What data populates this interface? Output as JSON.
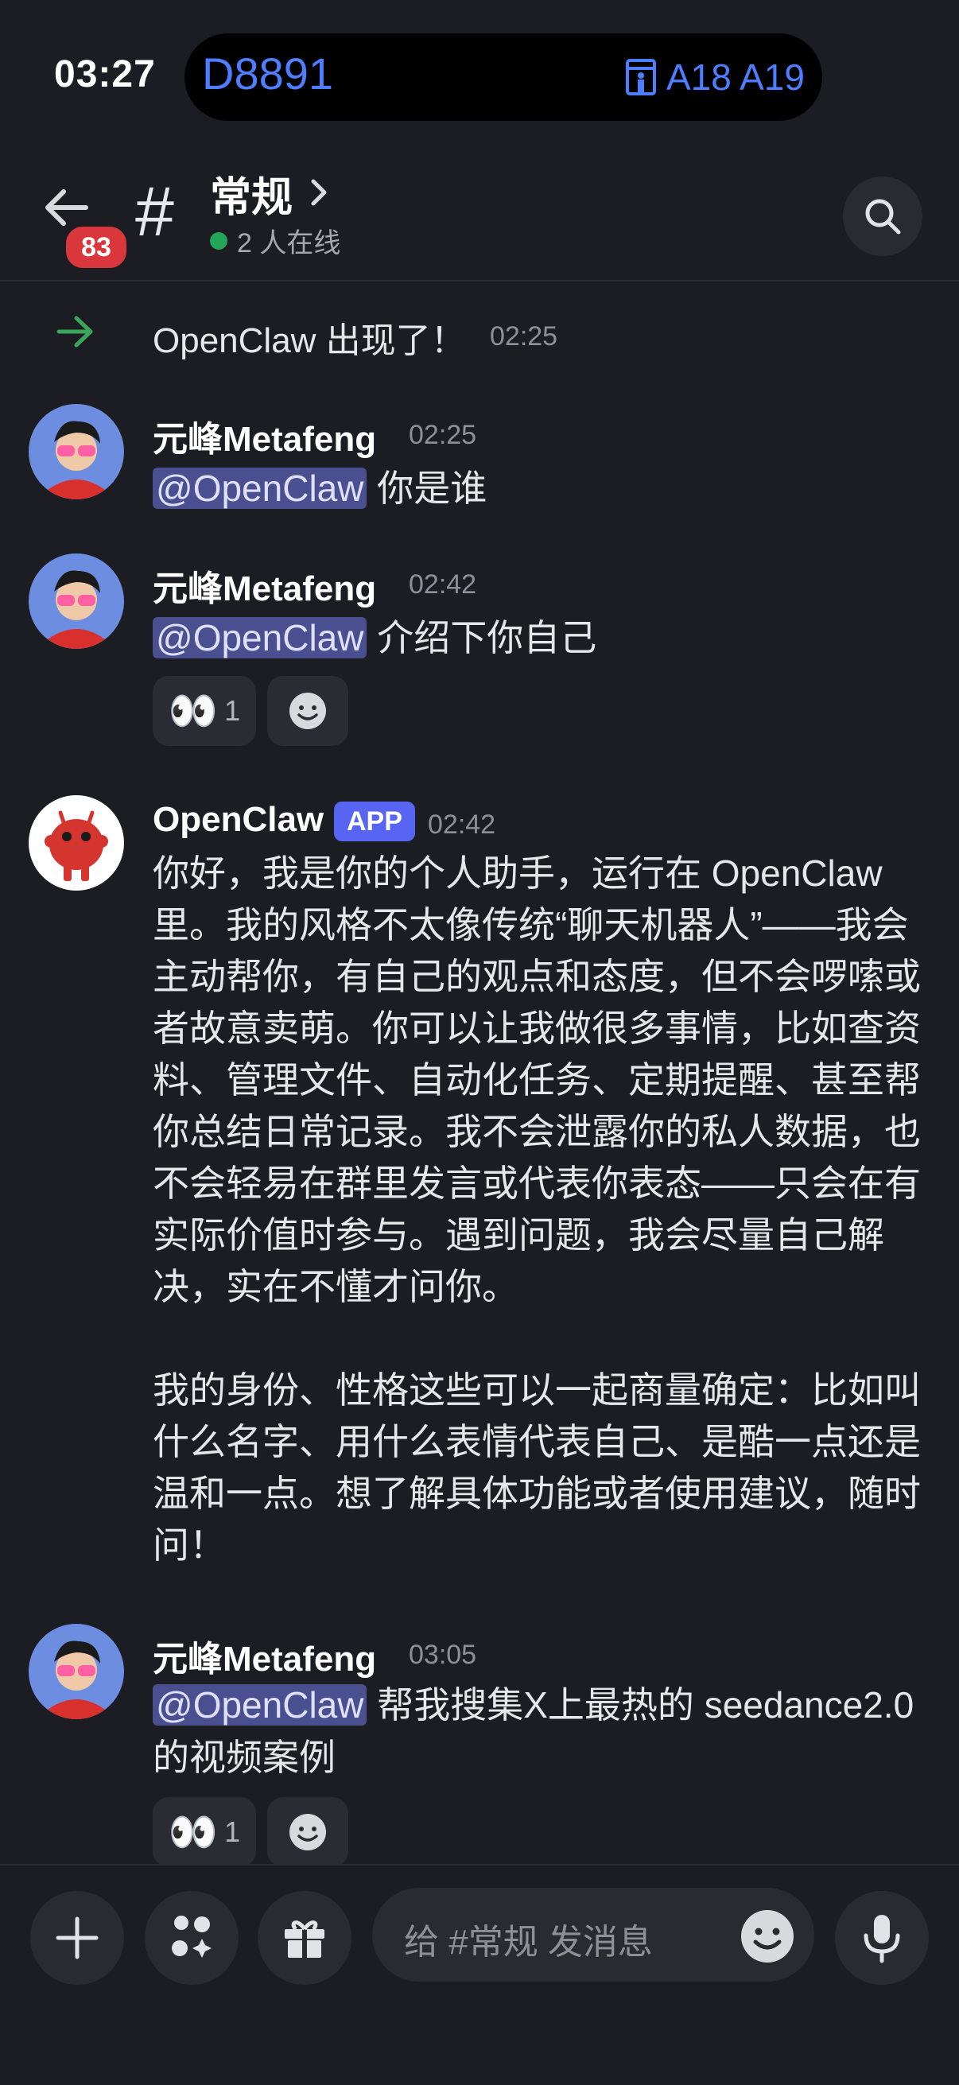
{
  "status_bar": {
    "time": "03:27",
    "flight": "D8891",
    "gates": "A18 A19"
  },
  "header": {
    "unread_badge": "83",
    "channel_name": "常规",
    "online": "2 人在线"
  },
  "messages": {
    "system": {
      "text": "OpenClaw 出现了！",
      "time": "02:25"
    },
    "m1": {
      "author": "元峰Metafeng",
      "time": "02:25",
      "mention": "@OpenClaw",
      "text": "你是谁"
    },
    "m2": {
      "author": "元峰Metafeng",
      "time": "02:42",
      "mention": "@OpenClaw",
      "text": "介绍下你自己",
      "reaction_emoji": "👀",
      "reaction_count": "1"
    },
    "bot": {
      "author": "OpenClaw",
      "tag": "APP",
      "time": "02:42",
      "para1": "你好，我是你的个人助手，运行在 OpenClaw 里。我的风格不太像传统“聊天机器人”——我会主动帮你，有自己的观点和态度，但不会啰嗦或者故意卖萌。你可以让我做很多事情，比如查资料、管理文件、自动化任务、定期提醒、甚至帮你总结日常记录。我不会泄露你的私人数据，也不会轻易在群里发言或代表你表态——只会在有实际价值时参与。遇到问题，我会尽量自己解决，实在不懂才问你。",
      "para2": "我的身份、性格这些可以一起商量确定：比如叫什么名字、用什么表情代表自己、是酷一点还是温和一点。想了解具体功能或者使用建议，随时问！"
    },
    "m3": {
      "author": "元峰Metafeng",
      "time": "03:05",
      "mention": "@OpenClaw",
      "text1": "帮我搜集X上最热的 seedance2.0",
      "text2": "的视频案例",
      "reaction_emoji": "👀",
      "reaction_count": "1"
    }
  },
  "composer": {
    "placeholder": "给 #常规 发消息"
  },
  "icons": [
    "back-arrow-icon",
    "hash-icon",
    "chevron-right-icon",
    "search-icon",
    "join-arrow-icon",
    "plus-icon",
    "apps-icon",
    "gift-icon",
    "emoji-icon",
    "microphone-icon",
    "gate-icon",
    "add-reaction-icon"
  ],
  "colors": {
    "accent": "#5865f2",
    "flight": "#4f7dff",
    "online": "#23a55a",
    "badge": "#da373c",
    "join_arrow": "#3ba55c"
  }
}
